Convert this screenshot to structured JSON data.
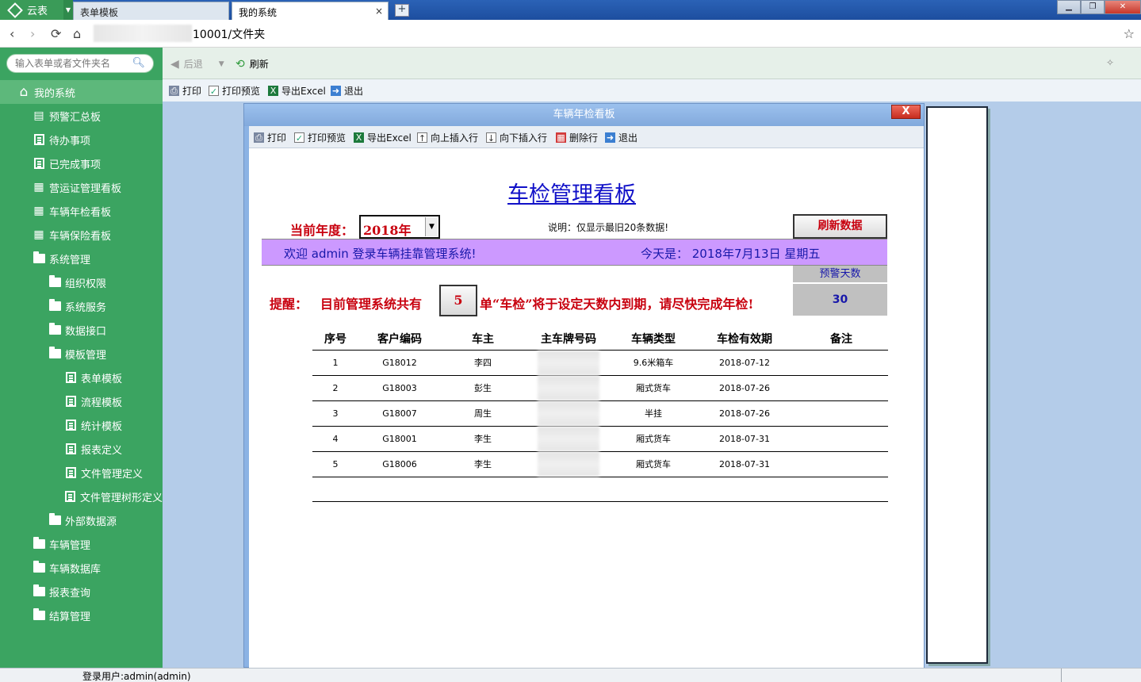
{
  "browser": {
    "app_name": "云表",
    "tabs": [
      {
        "label": "表单模板",
        "active": false
      },
      {
        "label": "我的系统",
        "active": true
      }
    ],
    "tab_close": "×",
    "new_tab": "+",
    "address_suffix": "10001/文件夹"
  },
  "sidebar": {
    "search_placeholder": "输入表单或者文件夹名",
    "items": [
      {
        "label": "我的系统",
        "level": 0,
        "icon": "home-icon",
        "selected": true
      },
      {
        "label": "预警汇总板",
        "level": 1,
        "icon": "clipboard-icon"
      },
      {
        "label": "待办事项",
        "level": 1,
        "icon": "list-icon"
      },
      {
        "label": "已完成事项",
        "level": 1,
        "icon": "list-icon"
      },
      {
        "label": "营运证管理看板",
        "level": 1,
        "icon": "calendar-icon"
      },
      {
        "label": "车辆年检看板",
        "level": 1,
        "icon": "calendar-icon"
      },
      {
        "label": "车辆保险看板",
        "level": 1,
        "icon": "calendar-icon"
      },
      {
        "label": "系统管理",
        "level": 1,
        "icon": "folder-icon"
      },
      {
        "label": "组织权限",
        "level": 2,
        "icon": "folder-icon"
      },
      {
        "label": "系统服务",
        "level": 2,
        "icon": "folder-icon"
      },
      {
        "label": "数据接口",
        "level": 2,
        "icon": "folder-icon"
      },
      {
        "label": "模板管理",
        "level": 2,
        "icon": "folder-icon"
      },
      {
        "label": "表单模板",
        "level": 3,
        "icon": "list-icon"
      },
      {
        "label": "流程模板",
        "level": 3,
        "icon": "list-icon"
      },
      {
        "label": "统计模板",
        "level": 3,
        "icon": "list-icon"
      },
      {
        "label": "报表定义",
        "level": 3,
        "icon": "list-icon"
      },
      {
        "label": "文件管理定义",
        "level": 3,
        "icon": "list-icon"
      },
      {
        "label": "文件管理树形定义",
        "level": 3,
        "icon": "list-icon"
      },
      {
        "label": "外部数据源",
        "level": 2,
        "icon": "folder-icon"
      },
      {
        "label": "车辆管理",
        "level": 1,
        "icon": "folder-icon"
      },
      {
        "label": "车辆数据库",
        "level": 1,
        "icon": "folder-icon"
      },
      {
        "label": "报表查询",
        "level": 1,
        "icon": "folder-icon"
      },
      {
        "label": "结算管理",
        "level": 1,
        "icon": "folder-icon"
      }
    ]
  },
  "main_toolbar": {
    "back": "后退",
    "refresh": "刷新"
  },
  "sub_toolbar": {
    "print": "打印",
    "print_preview": "打印预览",
    "export_excel": "导出Excel",
    "exit": "退出"
  },
  "modal": {
    "title": "车辆年检看板",
    "close": "X",
    "toolbar": {
      "print": "打印",
      "print_preview": "打印预览",
      "export_excel": "导出Excel",
      "insert_above": "向上插入行",
      "insert_below": "向下插入行",
      "delete_row": "删除行",
      "exit": "退出"
    }
  },
  "sheet": {
    "title": "车检管理看板",
    "year_label": "当前年度：",
    "year_value": "2018年",
    "note": "说明：仅显示最旧20条数据!",
    "refresh_button": "刷新数据",
    "welcome": "欢迎 admin   登录车辆挂靠管理系统!",
    "today": "今天是：  2018年7月13日  星期五",
    "warn_days_label": "预警天数",
    "warn_days_value": "30",
    "remind_prefix": "提醒：",
    "remind_text1": "目前管理系统共有",
    "remind_count": "5",
    "remind_text2": "单“车检”将于设定天数内到期，请尽快完成年检!",
    "table": {
      "headers": [
        "序号",
        "客户编码",
        "车主",
        "主车牌号码",
        "车辆类型",
        "车检有效期",
        "备注"
      ],
      "rows": [
        [
          "1",
          "G18012",
          "李四",
          "",
          "9.6米箱车",
          "2018-07-12",
          ""
        ],
        [
          "2",
          "G18003",
          "彭生",
          "",
          "厢式货车",
          "2018-07-26",
          ""
        ],
        [
          "3",
          "G18007",
          "周生",
          "",
          "半挂",
          "2018-07-26",
          ""
        ],
        [
          "4",
          "G18001",
          "李生",
          "",
          "厢式货车",
          "2018-07-31",
          ""
        ],
        [
          "5",
          "G18006",
          "李生",
          "",
          "厢式货车",
          "2018-07-31",
          ""
        ]
      ]
    }
  },
  "status": {
    "user": "登录用户:admin(admin)"
  },
  "colors": {
    "sidebar": "#3ba461",
    "accent_red": "#c8000e",
    "title_blue": "#1010c8",
    "welcome_purple": "#cc99ff"
  }
}
